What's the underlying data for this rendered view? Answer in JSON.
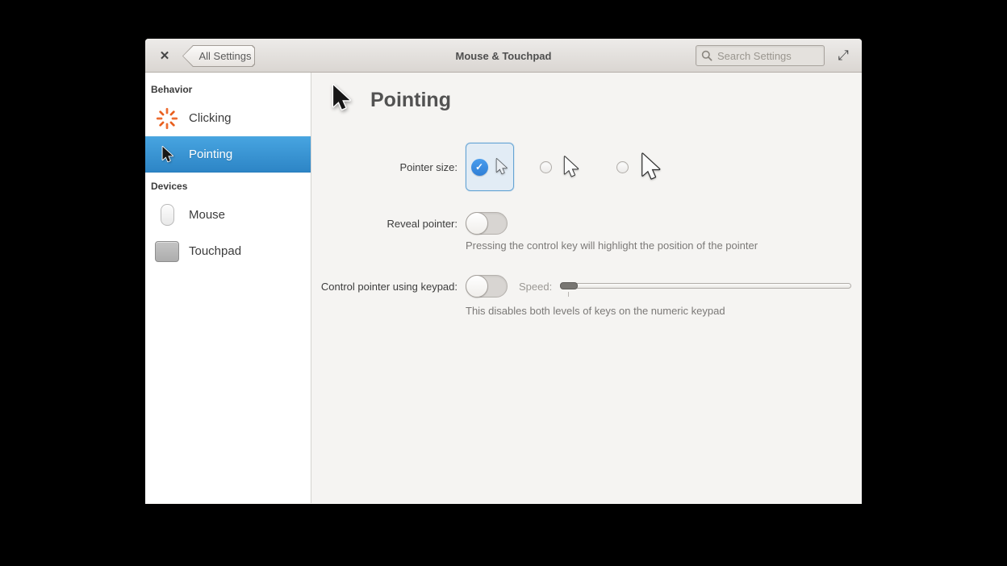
{
  "titlebar": {
    "close_icon": "✕",
    "back_button_label": "All Settings",
    "title": "Mouse & Touchpad",
    "search": {
      "placeholder": "Search Settings"
    },
    "expand_icon": "⤢"
  },
  "sidebar": {
    "sections": [
      {
        "header": "Behavior",
        "items": [
          {
            "label": "Clicking",
            "icon": "starburst-icon",
            "selected": false
          },
          {
            "label": "Pointing",
            "icon": "cursor-icon",
            "selected": true
          }
        ]
      },
      {
        "header": "Devices",
        "items": [
          {
            "label": "Mouse",
            "icon": "mouse-icon",
            "selected": false
          },
          {
            "label": "Touchpad",
            "icon": "touchpad-icon",
            "selected": false
          }
        ]
      }
    ]
  },
  "main": {
    "heading": "Pointing",
    "pointer_size": {
      "label": "Pointer size:",
      "check_icon": "✓",
      "options": [
        {
          "size": "small",
          "selected": true
        },
        {
          "size": "medium",
          "selected": false
        },
        {
          "size": "large",
          "selected": false
        }
      ]
    },
    "reveal_pointer": {
      "label": "Reveal pointer:",
      "enabled": false,
      "description": "Pressing the control key will highlight the position of the pointer"
    },
    "keypad_control": {
      "label": "Control pointer using keypad:",
      "enabled": false,
      "speed_label": "Speed:",
      "slider_value_percent": 0,
      "description": "This disables both levels of keys on the numeric keypad"
    }
  },
  "colors": {
    "accent": "#3689e6",
    "sidebar_selected_top": "#47a4e0",
    "sidebar_selected_bottom": "#2d85c6",
    "clicking_icon": "#ed6c30"
  }
}
